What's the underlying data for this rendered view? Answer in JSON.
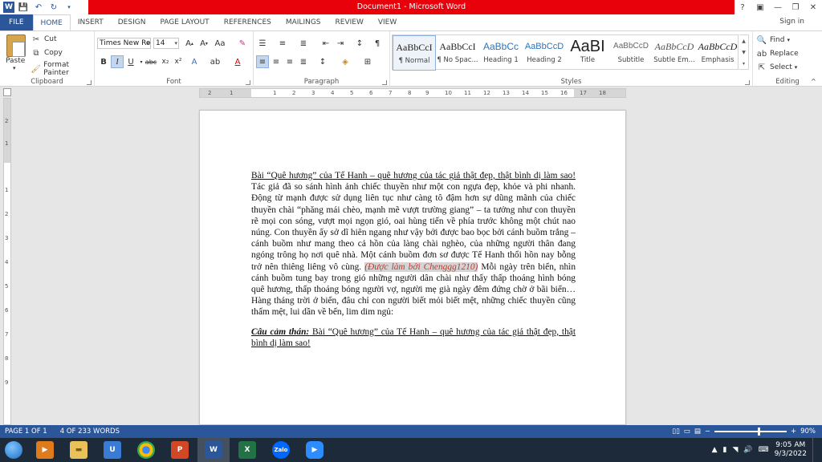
{
  "window": {
    "title": "Document1 - Microsoft Word",
    "help": "?",
    "sign_in": "Sign in"
  },
  "tabs": [
    {
      "label": "FILE"
    },
    {
      "label": "HOME"
    },
    {
      "label": "INSERT"
    },
    {
      "label": "DESIGN"
    },
    {
      "label": "PAGE LAYOUT"
    },
    {
      "label": "REFERENCES"
    },
    {
      "label": "MAILINGS"
    },
    {
      "label": "REVIEW"
    },
    {
      "label": "VIEW"
    }
  ],
  "clipboard": {
    "label": "Clipboard",
    "paste": "Paste",
    "cut": "Cut",
    "copy": "Copy",
    "format_painter": "Format Painter"
  },
  "font": {
    "label": "Font",
    "family": "Times New Ro",
    "size": "14"
  },
  "paragraph": {
    "label": "Paragraph"
  },
  "styles": {
    "label": "Styles",
    "items": [
      {
        "preview": "AaBbCcI",
        "name": "¶ Normal"
      },
      {
        "preview": "AaBbCcI",
        "name": "¶ No Spac..."
      },
      {
        "preview": "AaBbCc",
        "name": "Heading 1"
      },
      {
        "preview": "AaBbCcD",
        "name": "Heading 2"
      },
      {
        "preview": "AaBI",
        "name": "Title"
      },
      {
        "preview": "AaBbCcD",
        "name": "Subtitle"
      },
      {
        "preview": "AaBbCcD",
        "name": "Subtle Em..."
      },
      {
        "preview": "AaBbCcD",
        "name": "Emphasis"
      }
    ]
  },
  "editing": {
    "label": "Editing",
    "find": "Find",
    "replace": "Replace",
    "select": "Select"
  },
  "ruler": {
    "h_ticks": [
      "2",
      "1",
      "1",
      "2",
      "3",
      "4",
      "5",
      "6",
      "7",
      "8",
      "9",
      "10",
      "11",
      "12",
      "13",
      "14",
      "15",
      "16",
      "17",
      "18"
    ],
    "v_ticks": [
      "2",
      "1",
      "1",
      "2",
      "3",
      "4",
      "5",
      "6",
      "7",
      "8",
      "9"
    ]
  },
  "document": {
    "p1_title": "Bài “Quê hương” của Tế Hanh – quê hương của tác giả thật đẹp, thật bình dị làm sao!",
    "p1_body": " Tác giả đã so sánh hình ảnh chiếc thuyền như một con ngựa đẹp, khỏe và phi nhanh. Động từ mạnh được sử dụng liên tục như càng tô đậm hơn sự dũng mãnh của chiếc thuyền chài “phăng mái chèo, mạnh mẽ vượt trường giang” – ta tưởng như con thuyền rẽ mọi con sóng, vượt mọi ngọn gió, oai hùng tiến về phía trước không một chút nao núng. Con thuyền ấy sở dĩ hiên ngang như vậy bởi được bao bọc bởi cánh buồm trắng – cánh buồm như mang theo cả hồn của làng chài nghèo, của những người thân đang ngóng trông họ nơi quê nhà. Một cánh buồm đơn sơ được Tế Hanh thổi hồn nay bỗng trở nên thiêng liêng vô cùng. ",
    "p1_highlight": "(Được làm bởi Chenggg1210)",
    "p1_end": " Mỗi ngày trên biển, nhìn cánh buồm tung bay trong gió những người dân chài như thấy thấp thoáng hình bóng quê hương, thấp thoáng bóng người vợ, người mẹ già ngày đêm đứng chờ ở bãi biển…Hàng tháng trời ở biển, đâu chỉ con người biết mỏi biết mệt, những chiếc thuyền cũng thấm mệt, lui dần về bến, lim dim ngủ:",
    "p2_label": "Câu cảm thán:",
    "p2_text": " Bài “Quê hương” của Tế Hanh – quê hương của tác giả thật đẹp, thật bình dị làm sao!"
  },
  "status": {
    "page": "PAGE 1 OF 1",
    "words": "4 OF 233 WORDS",
    "zoom": "90%",
    "zoom_value": 0.6
  },
  "taskbar": {
    "zalo": "Zalo",
    "time": "9:05 AM",
    "date": "9/3/2022"
  }
}
